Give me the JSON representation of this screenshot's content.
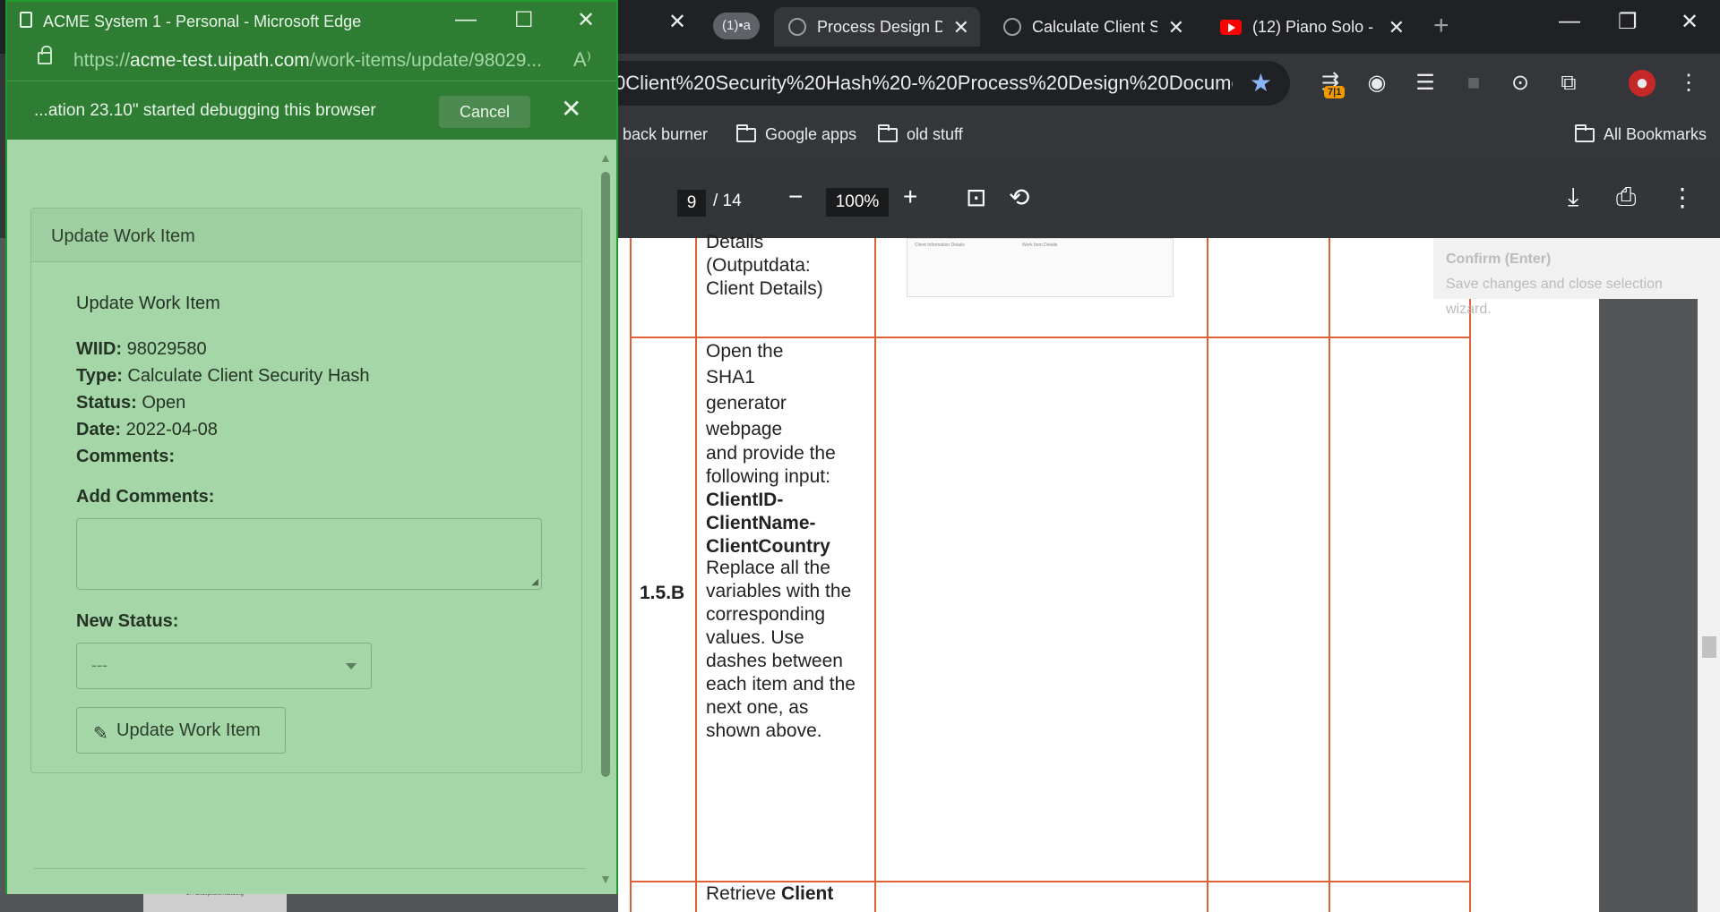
{
  "chrome": {
    "tabs": [
      {
        "label": "(1)•a",
        "type": "pill"
      },
      {
        "label": "Process Design Do",
        "active": true
      },
      {
        "label": "Calculate Client Se"
      },
      {
        "label": "(12) Piano Solo - C"
      }
    ],
    "url": "0Client%20Security%20Hash%20-%20Process%20Design%20Document%...",
    "extension_badge": "7|1",
    "bookmarks": [
      "back burner",
      "Google apps",
      "old stuff",
      "All Bookmarks"
    ],
    "pdf": {
      "page": "9",
      "page_total": "/ 14",
      "zoom": "100%"
    },
    "tooltip": {
      "title": "Confirm (Enter)",
      "body": "Save changes and close selection wizard."
    },
    "doc": {
      "row_prev_text": "Details\n(Outputdata:\nClient Details)",
      "row_id": "1.5.B",
      "row_text_1": "Open the\nSHA1\ngenerator\nwebpage",
      "row_text_2": "and provide the\nfollowing input:",
      "row_text_bold": "ClientID-\nClientName-\nClientCountry",
      "row_text_3": "Replace all the\nvariables with the\ncorresponding\nvalues. Use\ndashes between\neach item and the\nnext one, as\nshown above.",
      "row_next_text": "Retrieve",
      "row_next_bold": "Client",
      "thumb_left_title": "Client Information Details",
      "thumb_right_title": "Work Item Details",
      "mini_thumb": "2.4 Exceptions handling"
    }
  },
  "edge": {
    "title": "ACME System 1 - Personal - Microsoft Edge",
    "url_prefix": "https://",
    "url_host": "acme-test.uipath.com",
    "url_path": "/work-items/update/98029...",
    "infobar": "...ation 23.10\" started debugging this browser",
    "cancel_label": "Cancel",
    "card_header": "Update Work Item",
    "heading": "Update Work Item",
    "fields": {
      "wiid_label": "WIID:",
      "wiid": "98029580",
      "type_label": "Type:",
      "type": "Calculate Client Security Hash",
      "status_label": "Status:",
      "status": "Open",
      "date_label": "Date:",
      "date": "2022-04-08",
      "comments_label": "Comments:"
    },
    "add_comments_label": "Add Comments:",
    "new_status_label": "New Status:",
    "new_status_value": "---",
    "submit_label": "Update Work Item"
  }
}
